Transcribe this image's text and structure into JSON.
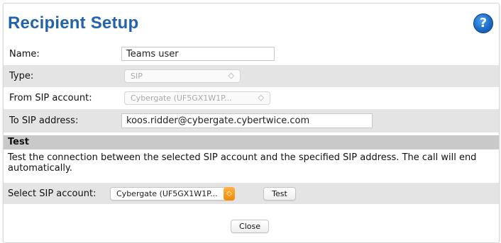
{
  "dialog": {
    "title": "Recipient Setup",
    "help_icon": "?"
  },
  "fields": {
    "name": {
      "label": "Name:",
      "value": "Teams user"
    },
    "type": {
      "label": "Type:",
      "value": "SIP",
      "chevron": "◇"
    },
    "from_sip": {
      "label": "From SIP account:",
      "value": "Cybergate (UF5GX1W1P...",
      "chevron": "◇"
    },
    "to_sip": {
      "label": "To SIP address:",
      "value": "koos.ridder@cybergate.cybertwice.com"
    }
  },
  "test_section": {
    "heading": "Test",
    "description": "Test the connection between the selected SIP account and the specified SIP address. The call will end automatically.",
    "select_label": "Select SIP account:",
    "select_value": "Cybergate (UF5GX1W1P...",
    "select_chevron": "◇",
    "test_button": "Test"
  },
  "footer": {
    "close_button": "Close"
  }
}
